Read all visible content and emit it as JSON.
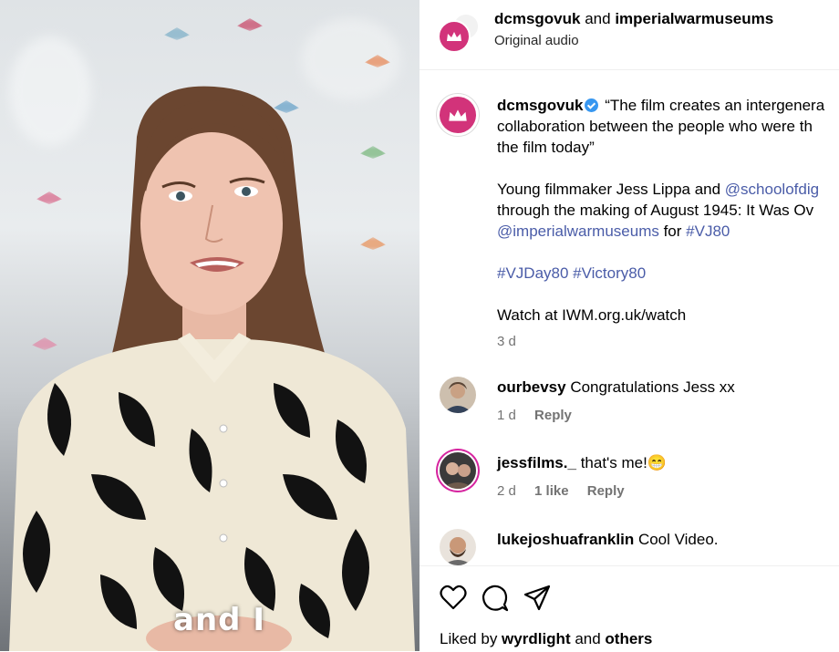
{
  "video": {
    "caption_overlay": "and I"
  },
  "header": {
    "account_primary": "dcmsgovuk",
    "joiner": "and",
    "account_secondary": "imperialwarmuseums",
    "audio_label": "Original audio"
  },
  "post": {
    "username": "dcmsgovuk",
    "quote_line1": "“The film creates an intergenera",
    "quote_line2": "collaboration between the people who were th",
    "quote_line3": "the film today”",
    "body_line1_text": "Young filmmaker Jess Lippa and ",
    "body_line1_mention": "@schoolofdig",
    "body_line2": "through the making of August 1945: It Was Ov",
    "body_line3_mention": "@imperialwarmuseums",
    "body_line3_for": " for ",
    "body_line3_hashtag": "#VJ80",
    "hashtags": "#VJDay80 #Victory80",
    "watch_line": "Watch at IWM.org.uk/watch",
    "age": "3 d"
  },
  "comments": [
    {
      "username": "ourbevsy",
      "text": "Congratulations Jess xx",
      "age": "1 d",
      "likes": "",
      "reply": "Reply"
    },
    {
      "username": "jessfilms._",
      "text": "that's me!😁",
      "age": "2 d",
      "likes": "1 like",
      "reply": "Reply"
    },
    {
      "username": "lukejoshuafranklin",
      "text": "Cool Video.",
      "age": "",
      "likes": "",
      "reply": ""
    }
  ],
  "footer": {
    "liked_prefix": "Liked by ",
    "liked_user": "wyrdlight",
    "liked_mid": " and ",
    "liked_others": "others"
  },
  "icons": [
    "heart-icon",
    "comment-icon",
    "share-icon",
    "verified-badge-icon",
    "crown-logo-icon"
  ],
  "colors": {
    "brand_pink": "#d2337a",
    "link_blue": "#4a5ca8",
    "verified_blue": "#3897f0",
    "muted": "#737373"
  }
}
